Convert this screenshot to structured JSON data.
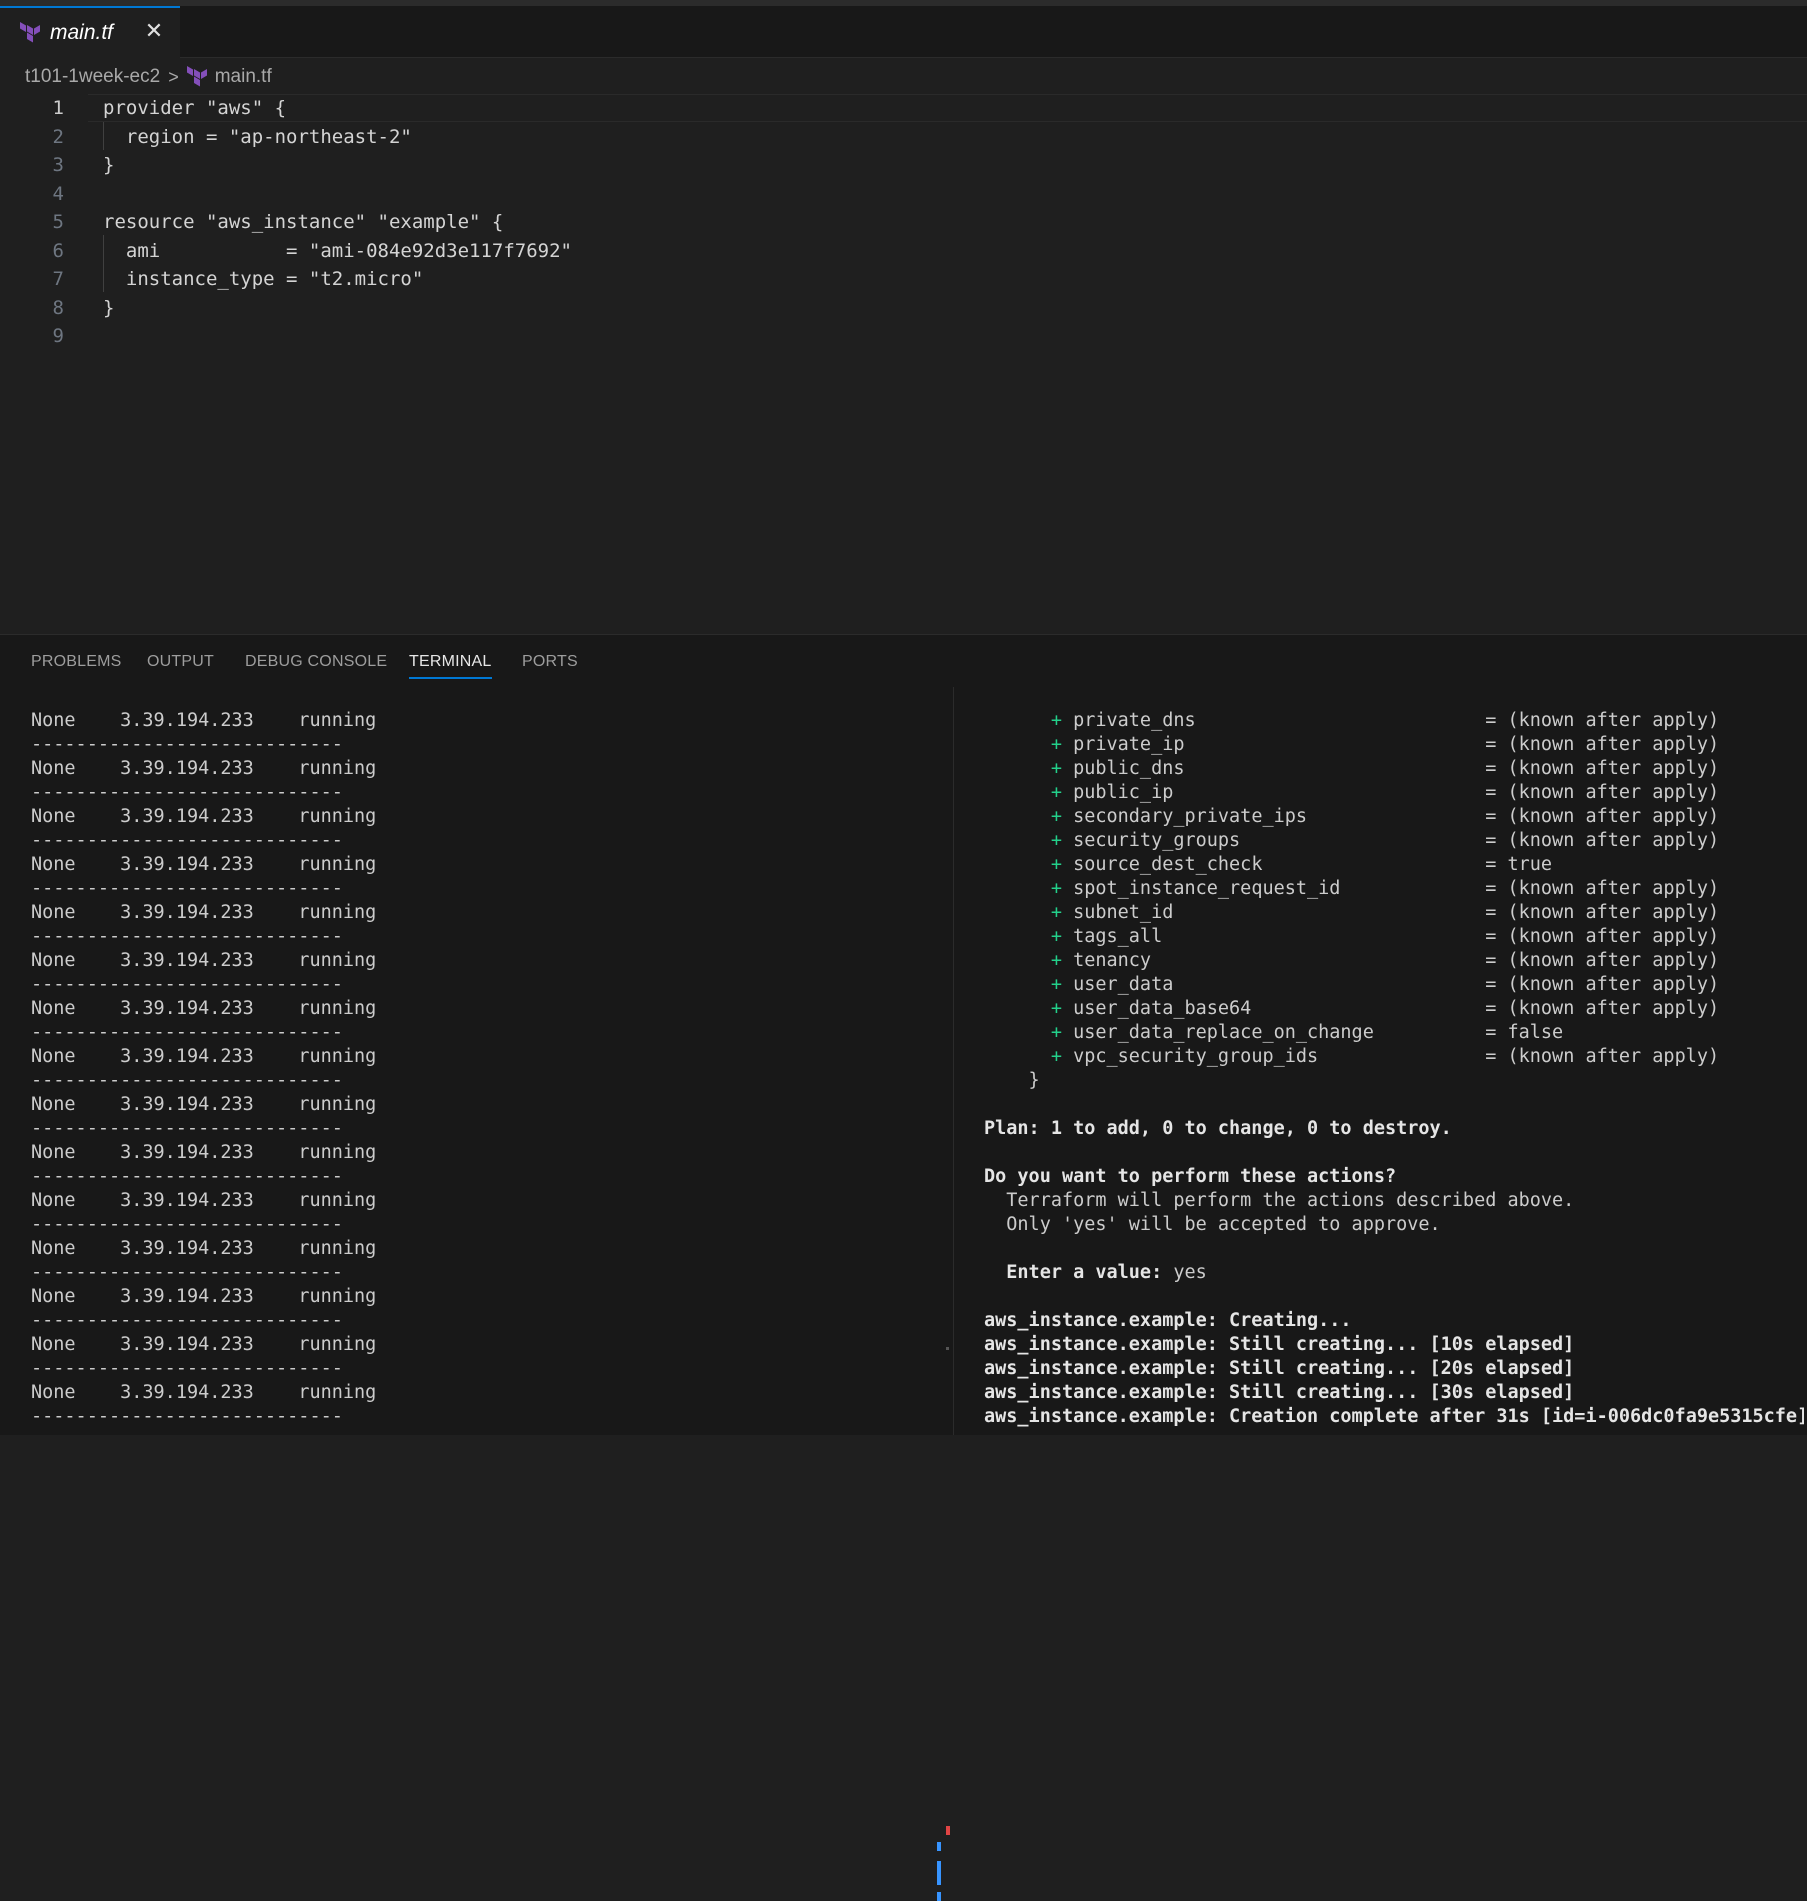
{
  "tab": {
    "label": "main.tf",
    "close": "✕"
  },
  "breadcrumb": {
    "folder": "t101-1week-ec2",
    "separator": ">",
    "file": "main.tf"
  },
  "editor": {
    "active_line": 1,
    "lines": [
      {
        "n": "1",
        "text": "provider \"aws\" {"
      },
      {
        "n": "2",
        "text": "  region = \"ap-northeast-2\""
      },
      {
        "n": "3",
        "text": "}"
      },
      {
        "n": "4",
        "text": ""
      },
      {
        "n": "5",
        "text": "resource \"aws_instance\" \"example\" {"
      },
      {
        "n": "6",
        "text": "  ami           = \"ami-084e92d3e117f7692\""
      },
      {
        "n": "7",
        "text": "  instance_type = \"t2.micro\""
      },
      {
        "n": "8",
        "text": "}"
      },
      {
        "n": "9",
        "text": ""
      }
    ]
  },
  "panel_tabs": [
    "PROBLEMS",
    "OUTPUT",
    "DEBUG CONSOLE",
    "TERMINAL",
    "PORTS"
  ],
  "active_panel_tab": "TERMINAL",
  "terminal_left": {
    "row": {
      "name": "None",
      "ip": "3.39.194.233",
      "state": "running"
    },
    "separator": "----------------------------",
    "repeat": 15
  },
  "terminal_right": {
    "attributes": [
      {
        "name": "private_dns",
        "value": "(known after apply)"
      },
      {
        "name": "private_ip",
        "value": "(known after apply)"
      },
      {
        "name": "public_dns",
        "value": "(known after apply)"
      },
      {
        "name": "public_ip",
        "value": "(known after apply)"
      },
      {
        "name": "secondary_private_ips",
        "value": "(known after apply)"
      },
      {
        "name": "security_groups",
        "value": "(known after apply)"
      },
      {
        "name": "source_dest_check",
        "value": "true"
      },
      {
        "name": "spot_instance_request_id",
        "value": "(known after apply)"
      },
      {
        "name": "subnet_id",
        "value": "(known after apply)"
      },
      {
        "name": "tags_all",
        "value": "(known after apply)"
      },
      {
        "name": "tenancy",
        "value": "(known after apply)"
      },
      {
        "name": "user_data",
        "value": "(known after apply)"
      },
      {
        "name": "user_data_base64",
        "value": "(known after apply)"
      },
      {
        "name": "user_data_replace_on_change",
        "value": "false"
      },
      {
        "name": "vpc_security_group_ids",
        "value": "(known after apply)"
      }
    ],
    "close_brace": "    }",
    "plan": "Plan: 1 to add, 0 to change, 0 to destroy.",
    "prompt_title": "Do you want to perform these actions?",
    "prompt_lines": [
      "  Terraform will perform the actions described above.",
      "  Only 'yes' will be accepted to approve."
    ],
    "enter_label": "  Enter a value: ",
    "enter_value": "yes",
    "progress": [
      "aws_instance.example: Creating...",
      "aws_instance.example: Still creating... [10s elapsed]",
      "aws_instance.example: Still creating... [20s elapsed]",
      "aws_instance.example: Still creating... [30s elapsed]",
      "aws_instance.example: Creation complete after 31s [id=i-006dc0fa9e5315cfe]"
    ]
  },
  "colors": {
    "accent": "#0078d4",
    "plus": "#23d18b",
    "terraform": "#844fba"
  }
}
